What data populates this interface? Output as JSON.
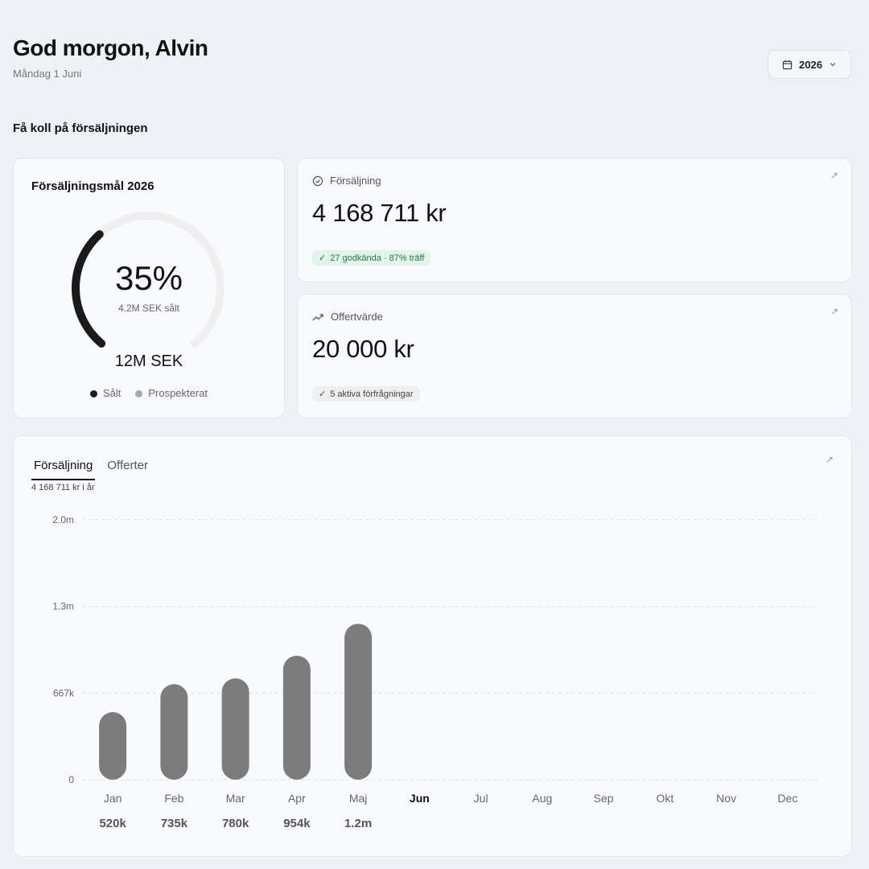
{
  "header": {
    "greeting": "God morgon, Alvin",
    "date": "Måndag 1 Juni",
    "year_select": "2026"
  },
  "section_title": "Få koll på försäljningen",
  "goal_card": {
    "title": "Försäljningsmål 2026",
    "percent": "35%",
    "progress": 0.35,
    "sold_text": "4.2M SEK sålt",
    "target": "12M SEK",
    "legend": [
      {
        "label": "Sålt",
        "color": "#1a1a1a"
      },
      {
        "label": "Prospekterat",
        "color": "#a9a9a9"
      }
    ]
  },
  "kpi_sales": {
    "label": "Försäljning",
    "value": "4 168 711 kr",
    "badge": "27 godkända · 87% träff"
  },
  "kpi_offers": {
    "label": "Offertvärde",
    "value": "20 000 kr",
    "badge": "5 aktiva förfrågningar"
  },
  "chart_card": {
    "tabs": [
      {
        "label": "Försäljning",
        "active": true
      },
      {
        "label": "Offerter",
        "active": false
      }
    ],
    "subtitle": "4 168 711 kr i år"
  },
  "colors": {
    "bar": "#7b7c7b",
    "accent_green": "#1f7a44",
    "grid": "#dcdfe4"
  },
  "chart_data": {
    "type": "bar",
    "categories": [
      "Jan",
      "Feb",
      "Mar",
      "Apr",
      "Maj",
      "Jun",
      "Jul",
      "Aug",
      "Sep",
      "Okt",
      "Nov",
      "Dec"
    ],
    "values": [
      520000,
      735000,
      780000,
      954000,
      1200000,
      null,
      null,
      null,
      null,
      null,
      null,
      null
    ],
    "value_labels": [
      "520k",
      "735k",
      "780k",
      "954k",
      "1.2m",
      "",
      "",
      "",
      "",
      "",
      "",
      ""
    ],
    "current_category": "Jun",
    "y_ticks": [
      {
        "value": 0,
        "label": "0"
      },
      {
        "value": 667000,
        "label": "667k"
      },
      {
        "value": 1333000,
        "label": "1.3m"
      },
      {
        "value": 2000000,
        "label": "2.0m"
      }
    ],
    "ylim": [
      0,
      2000000
    ],
    "grid": true,
    "title": "",
    "xlabel": "",
    "ylabel": ""
  }
}
